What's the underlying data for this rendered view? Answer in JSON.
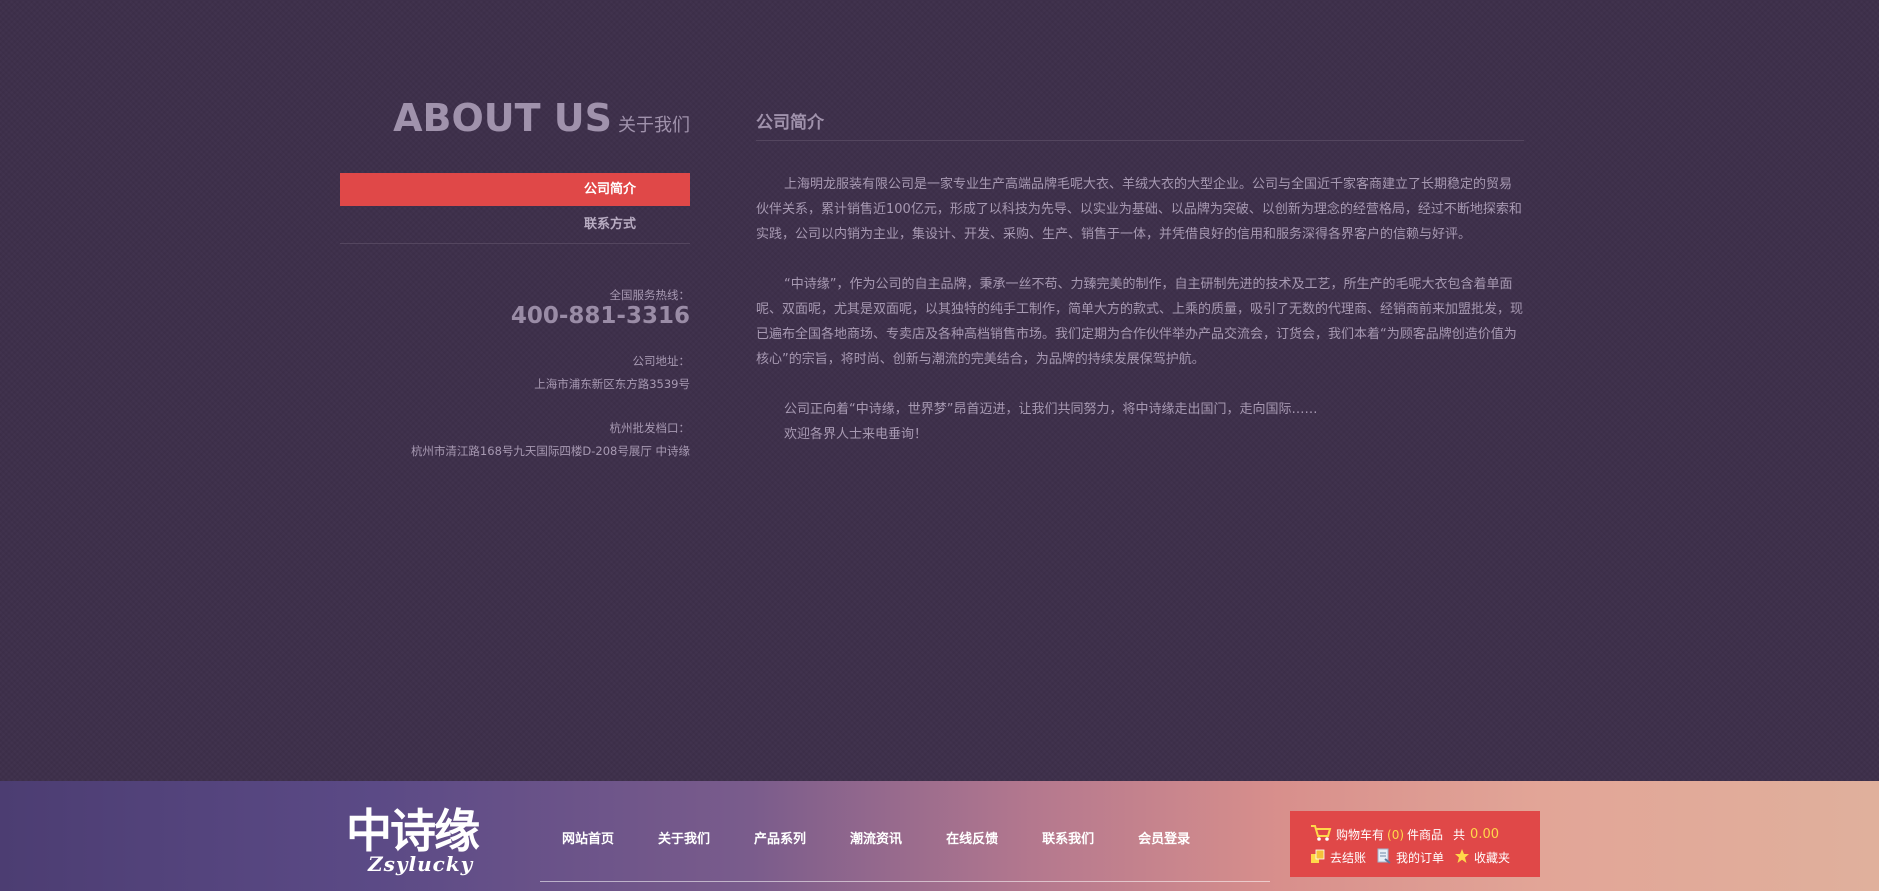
{
  "about": {
    "title": "ABOUT US",
    "subtitle": "关于我们"
  },
  "side_nav": {
    "items": [
      {
        "label": "公司简介",
        "active": true
      },
      {
        "label": "联系方式",
        "active": false
      }
    ]
  },
  "contact": {
    "hotline_label": "全国服务热线：",
    "hotline_number": "400-881-3316",
    "address_label": "公司地址：",
    "address_value": "上海市浦东新区东方路3539号",
    "hangzhou_label": "杭州批发档口：",
    "hangzhou_value": "杭州市清江路168号九天国际四楼D-208号展厅 中诗缘"
  },
  "content": {
    "title": "公司简介",
    "paragraphs": [
      "上海明龙服装有限公司是一家专业生产高端品牌毛呢大衣、羊绒大衣的大型企业。公司与全国近千家客商建立了长期稳定的贸易伙伴关系，累计销售近100亿元，形成了以科技为先导、以实业为基础、以品牌为突破、以创新为理念的经营格局，经过不断地探索和实践，公司以内销为主业，集设计、开发、采购、生产、销售于一体，并凭借良好的信用和服务深得各界客户的信赖与好评。",
      "“中诗缘”，作为公司的自主品牌，秉承一丝不苟、力臻完美的制作，自主研制先进的技术及工艺，所生产的毛呢大衣包含着单面呢、双面呢，尤其是双面呢，以其独特的纯手工制作，简单大方的款式、上乘的质量，吸引了无数的代理商、经销商前来加盟批发，现已遍布全国各地商场、专卖店及各种高档销售市场。我们定期为合作伙伴举办产品交流会，订货会，我们本着“为顾客品牌创造价值为核心”的宗旨，将时尚、创新与潮流的完美结合，为品牌的持续发展保驾护航。",
      "公司正向着“中诗缘，世界梦”昂首迈进，让我们共同努力，将中诗缘走出国门，走向国际……",
      "欢迎各界人士来电垂询！"
    ]
  },
  "footer": {
    "logo_cn": "中诗缘",
    "logo_en": "Zsylucky",
    "nav": [
      "网站首页",
      "关于我们",
      "产品系列",
      "潮流资讯",
      "在线反馈",
      "联系我们",
      "会员登录"
    ],
    "cart": {
      "label": "购物车有",
      "count": "(0)",
      "unit": "件商品",
      "total_label": "共",
      "total": "0.00",
      "checkout": "去结账",
      "orders": "我的订单",
      "favorites": "收藏夹"
    }
  },
  "colors": {
    "background": "#3d2f4a",
    "accent": "#e04848",
    "highlight": "#ffd84a"
  }
}
